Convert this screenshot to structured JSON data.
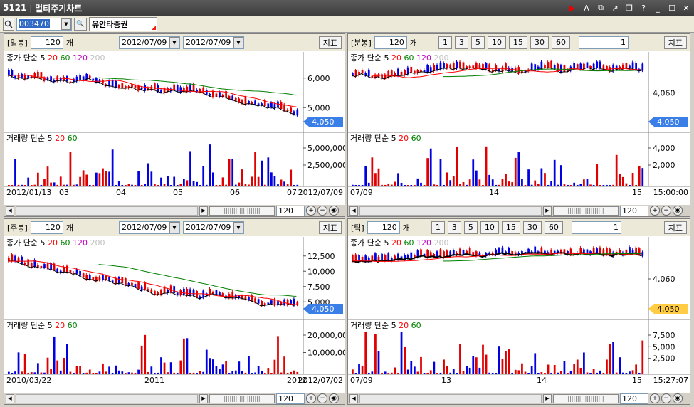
{
  "window": {
    "screen_no": "5121",
    "title": "멀티주기차트"
  },
  "toolbar": {
    "code": "003470",
    "stock_name": "유안타증권"
  },
  "ui": {
    "count_unit": "개",
    "indicator_btn": "지표"
  },
  "colors": {
    "up": "#e00000",
    "down": "#0000e0",
    "ma5": "#000000",
    "ma20": "#ff0000",
    "ma60": "#008000",
    "ma120": "#c000c0",
    "ma200": "#c0c0c0",
    "price_tag": "#3a7ee8",
    "tick_tag": "#ffcc44"
  },
  "panels": [
    {
      "id": "daily",
      "period": "[일봉]",
      "count": "120",
      "date1": "2012/07/09",
      "date2": "2012/07/09",
      "price_legend": {
        "prefix": "종가",
        "type": "단순",
        "ma": [
          "5",
          "20",
          "60",
          "120",
          "200"
        ]
      },
      "price_ticks": [
        "6,000",
        "5,000"
      ],
      "current_price": "4,050",
      "vol_legend": {
        "prefix": "거래량",
        "type": "단순",
        "ma": [
          "5",
          "20",
          "60"
        ]
      },
      "vol_ticks": [
        "5,000,000",
        "2,500,000"
      ],
      "x_labels": [
        "2012/01/13",
        "03",
        "04",
        "05",
        "06",
        "07"
      ],
      "x_right": "2012/07/09",
      "zoom": "120"
    },
    {
      "id": "minute",
      "period": "[분봉]",
      "count": "120",
      "intervals": [
        "1",
        "3",
        "5",
        "10",
        "15",
        "30",
        "60"
      ],
      "unit_value": "1",
      "price_legend": {
        "prefix": "종가",
        "type": "단순",
        "ma": [
          "5",
          "20",
          "60",
          "120",
          "200"
        ]
      },
      "price_ticks": [
        "4,060"
      ],
      "current_price": "4,050",
      "vol_legend": {
        "prefix": "거래량",
        "type": "단순",
        "ma": [
          "5",
          "20",
          "60"
        ]
      },
      "vol_ticks": [
        "4,000",
        "2,000"
      ],
      "x_labels": [
        "07/09",
        "14",
        "15"
      ],
      "x_right": "15:00:00",
      "zoom": "120"
    },
    {
      "id": "weekly",
      "period": "[주봉]",
      "count": "120",
      "date1": "2012/07/09",
      "date2": "2012/07/09",
      "price_legend": {
        "prefix": "종가",
        "type": "단순",
        "ma": [
          "5",
          "20",
          "60",
          "120",
          "200"
        ]
      },
      "price_ticks": [
        "12,500",
        "10,000",
        "7,500",
        "5,000"
      ],
      "current_price": "4,050",
      "vol_legend": {
        "prefix": "거래량",
        "type": "단순",
        "ma": [
          "5",
          "20",
          "60"
        ]
      },
      "vol_ticks": [
        "20,000,000",
        "10,000,000"
      ],
      "x_labels": [
        "2010/03/22",
        "2011",
        "2012"
      ],
      "x_right": "2012/07/02",
      "zoom": "120"
    },
    {
      "id": "tick",
      "period": "[틱]",
      "count": "120",
      "intervals": [
        "1",
        "3",
        "5",
        "10",
        "15",
        "30",
        "60"
      ],
      "unit_value": "1",
      "price_legend": {
        "prefix": "종가",
        "type": "단순",
        "ma": [
          "5",
          "20",
          "60",
          "120",
          "200"
        ]
      },
      "price_ticks": [
        "4,060"
      ],
      "current_price": "4,050",
      "vol_legend": {
        "prefix": "거래량",
        "type": "단순",
        "ma": [
          "5",
          "20",
          "60"
        ]
      },
      "vol_ticks": [
        "7,500",
        "5,000",
        "2,500"
      ],
      "x_labels": [
        "07/09",
        "13",
        "14",
        "15"
      ],
      "x_right": "15:27:07",
      "zoom": "120"
    }
  ]
}
